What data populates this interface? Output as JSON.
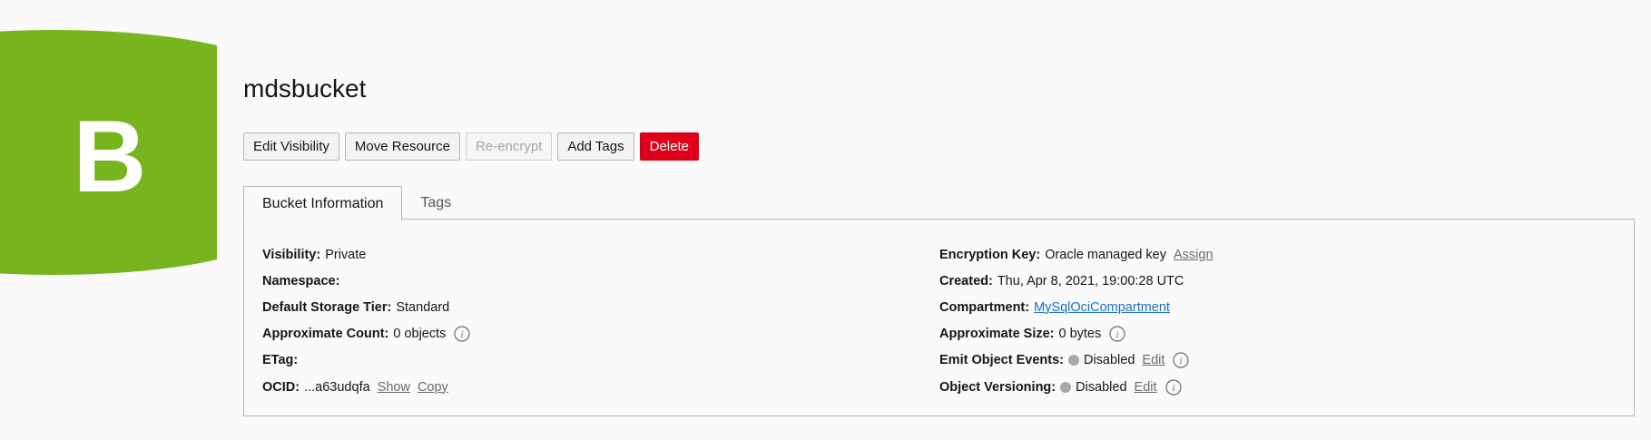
{
  "badge": {
    "letter": "B",
    "color": "#78b41e"
  },
  "header": {
    "title": "mdsbucket"
  },
  "actions": {
    "edit_visibility": "Edit Visibility",
    "move_resource": "Move Resource",
    "re_encrypt": "Re-encrypt",
    "add_tags": "Add Tags",
    "delete": "Delete"
  },
  "tabs": [
    {
      "label": "Bucket Information",
      "active": true
    },
    {
      "label": "Tags",
      "active": false
    }
  ],
  "info": {
    "left": {
      "visibility": {
        "label": "Visibility:",
        "value": "Private"
      },
      "namespace": {
        "label": "Namespace:",
        "value": ""
      },
      "storage_tier": {
        "label": "Default Storage Tier:",
        "value": "Standard"
      },
      "approx_count": {
        "label": "Approximate Count:",
        "value": "0 objects"
      },
      "etag": {
        "label": "ETag:",
        "value": ""
      },
      "ocid": {
        "label": "OCID:",
        "value": "...a63udqfa",
        "show": "Show",
        "copy": "Copy"
      }
    },
    "right": {
      "encryption_key": {
        "label": "Encryption Key:",
        "value": "Oracle managed key",
        "action": "Assign"
      },
      "created": {
        "label": "Created:",
        "value": "Thu, Apr 8, 2021, 19:00:28 UTC"
      },
      "compartment": {
        "label": "Compartment:",
        "value": "MySqlOciCompartment"
      },
      "approx_size": {
        "label": "Approximate Size:",
        "value": "0 bytes"
      },
      "emit_events": {
        "label": "Emit Object Events:",
        "status": "Disabled",
        "action": "Edit"
      },
      "versioning": {
        "label": "Object Versioning:",
        "status": "Disabled",
        "action": "Edit"
      }
    }
  },
  "colors": {
    "accent_green": "#78b41e",
    "danger": "#e0001a",
    "link_blue": "#1a6fc4",
    "disabled_dot": "#a8a8a8"
  },
  "icons": {
    "info": "info-circle-icon",
    "status": "status-dot-icon"
  }
}
